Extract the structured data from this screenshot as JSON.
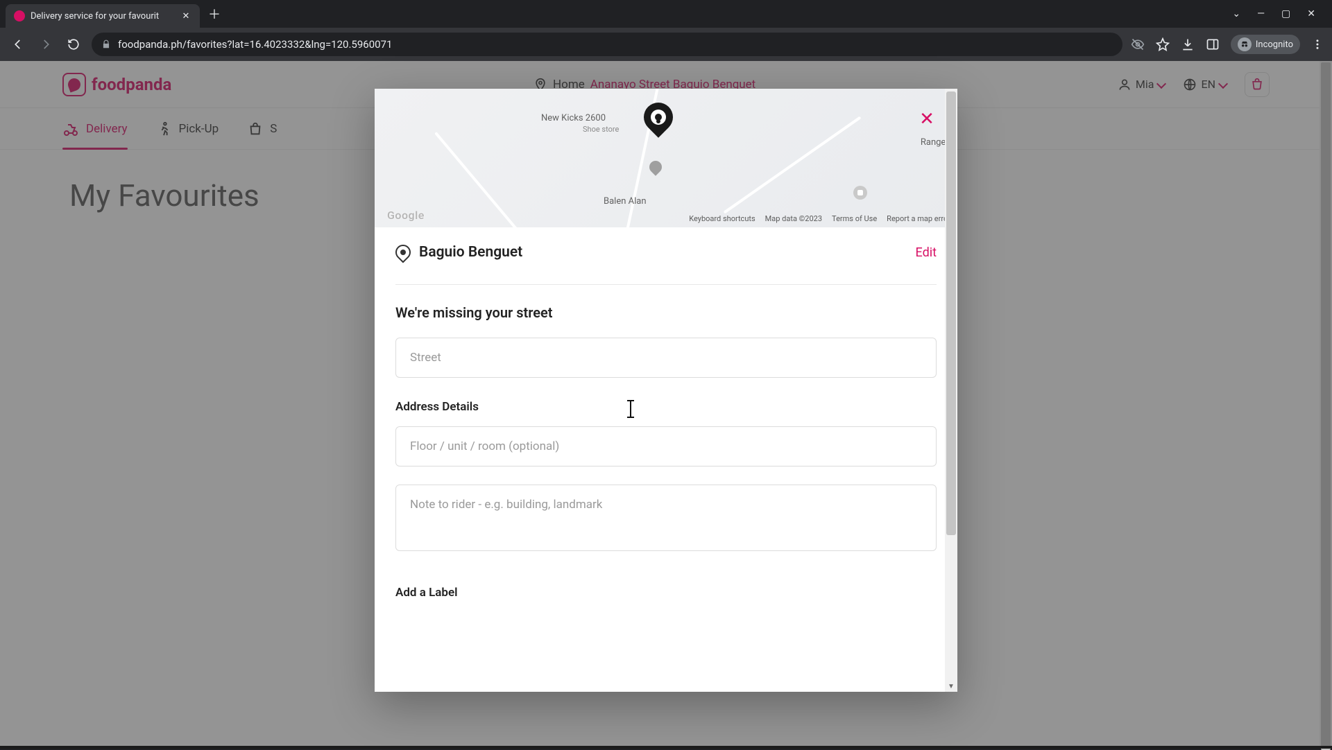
{
  "browser": {
    "tab_title": "Delivery service for your favourit",
    "url": "foodpanda.ph/favorites?lat=16.4023332&lng=120.5960071",
    "incognito_label": "Incognito"
  },
  "header": {
    "brand": "foodpanda",
    "location_prefix": "Home",
    "location_address": "Ananayo Street Baguio Benguet",
    "user_name": "Mia",
    "language": "EN"
  },
  "tabs": {
    "delivery": "Delivery",
    "pickup": "Pick-Up",
    "shops": "S"
  },
  "page": {
    "title": "My Favourites"
  },
  "modal": {
    "map": {
      "poi1_name": "New Kicks 2600",
      "poi1_sub": "Shoe store",
      "poi2_name": "Balen Alan",
      "poi3_name": "Ranger Sta",
      "google": "Google",
      "keyboard": "Keyboard shortcuts",
      "mapdata": "Map data ©2023",
      "terms": "Terms of Use",
      "report": "Report a map error"
    },
    "location_name": "Baguio Benguet",
    "edit": "Edit",
    "missing_heading": "We're missing your street",
    "street_placeholder": "Street",
    "details_heading": "Address Details",
    "floor_placeholder": "Floor / unit / room (optional)",
    "note_placeholder": "Note to rider - e.g. building, landmark",
    "label_heading": "Add a Label"
  }
}
